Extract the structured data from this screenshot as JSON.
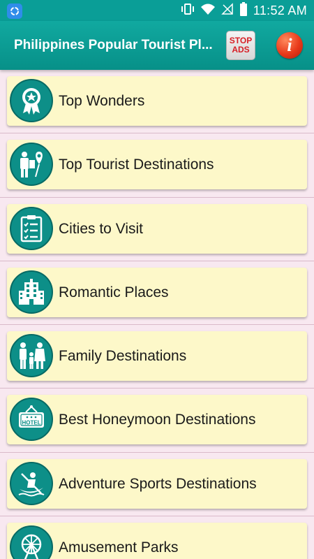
{
  "status_bar": {
    "time": "11:52 AM",
    "icons": [
      "app-notification-icon",
      "vibrate-icon",
      "wifi-icon",
      "no-signal-icon",
      "battery-icon"
    ]
  },
  "app_bar": {
    "title": "Philippines Popular Tourist Pl...",
    "stop_ads_line1": "STOP",
    "stop_ads_line2": "ADS",
    "info_label": "i"
  },
  "menu": {
    "items": [
      {
        "label": "Top Wonders",
        "icon": "award-badge-icon"
      },
      {
        "label": "Top Tourist Destinations",
        "icon": "tourist-location-icon"
      },
      {
        "label": "Cities to Visit",
        "icon": "checklist-clipboard-icon"
      },
      {
        "label": "Romantic Places",
        "icon": "building-icon"
      },
      {
        "label": "Family Destinations",
        "icon": "family-icon"
      },
      {
        "label": "Best Honeymoon Destinations",
        "icon": "hotel-sign-icon"
      },
      {
        "label": "Adventure Sports Destinations",
        "icon": "kayak-icon"
      },
      {
        "label": "Amusement Parks",
        "icon": "ferris-wheel-icon"
      }
    ]
  },
  "colors": {
    "header": "#0a9e97",
    "card_background": "#fdf8c9",
    "page_background": "#f8e8f0",
    "icon_circle": "#0d8f88"
  }
}
